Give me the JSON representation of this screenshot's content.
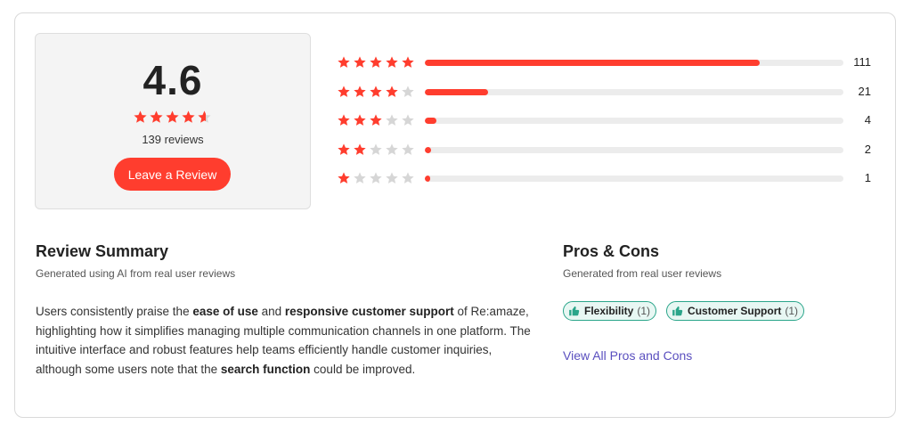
{
  "rating": {
    "average": "4.6",
    "average_value": 4.6,
    "reviews_label": "139 reviews",
    "leave_review_label": "Leave a Review"
  },
  "distribution": [
    {
      "stars": 5,
      "count": "111",
      "fraction": 0.8
    },
    {
      "stars": 4,
      "count": "21",
      "fraction": 0.15
    },
    {
      "stars": 3,
      "count": "4",
      "fraction": 0.028
    },
    {
      "stars": 2,
      "count": "2",
      "fraction": 0.014
    },
    {
      "stars": 1,
      "count": "1",
      "fraction": 0.007
    }
  ],
  "summary": {
    "title": "Review Summary",
    "subtitle": "Generated using AI from real user reviews",
    "body": [
      {
        "text": "Users consistently praise the ",
        "bold": false
      },
      {
        "text": "ease of use",
        "bold": true
      },
      {
        "text": " and ",
        "bold": false
      },
      {
        "text": "responsive customer support",
        "bold": true
      },
      {
        "text": " of Re:amaze, highlighting how it simplifies managing multiple communication channels in one platform. The intuitive interface and robust features help teams efficiently handle customer inquiries, although some users note that the ",
        "bold": false
      },
      {
        "text": "search function",
        "bold": true
      },
      {
        "text": " could be improved.",
        "bold": false
      }
    ]
  },
  "pros_cons": {
    "title": "Pros & Cons",
    "subtitle": "Generated from real user reviews",
    "tags": [
      {
        "label": "Flexibility",
        "count": "(1)",
        "icon": "thumbs-up-icon"
      },
      {
        "label": "Customer Support",
        "count": "(1)",
        "icon": "thumbs-up-icon"
      }
    ],
    "view_all_label": "View All Pros and Cons"
  },
  "colors": {
    "accent": "#ff3d2e",
    "star_empty": "#d6d6d6",
    "tag_border": "#2aa58a",
    "tag_bg": "#e8f7f3",
    "link": "#5a4fbf"
  }
}
